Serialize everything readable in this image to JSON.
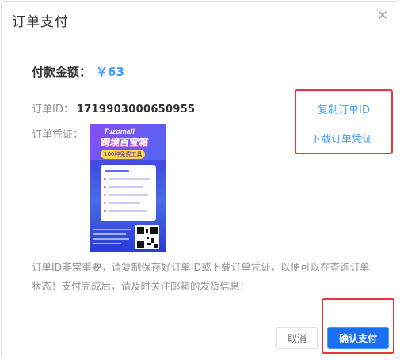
{
  "dialog": {
    "title": "订单支付",
    "close_icon": "close-icon"
  },
  "amount": {
    "label": "付款金额：",
    "value": "￥63"
  },
  "order": {
    "id_label": "订单ID：",
    "id_value": "1719903000650955",
    "voucher_label": "订单凭证："
  },
  "voucher_image": {
    "brand": "Tuzomall",
    "title": "跨境百宝箱",
    "subtitle": "100种免费工具"
  },
  "links": {
    "copy_id": "复制订单ID",
    "download_voucher": "下载订单凭证"
  },
  "notice": "订单ID非常重要，请复制保存好订单ID或下载订单凭证，以便可以在查询订单状态！支付完成后，请及时关注邮箱的发货信息！",
  "buttons": {
    "cancel": "取消",
    "confirm": "确认支付"
  },
  "colors": {
    "accent": "#409eff",
    "primary_button": "#1d6ff2",
    "highlight": "#e8343c"
  }
}
